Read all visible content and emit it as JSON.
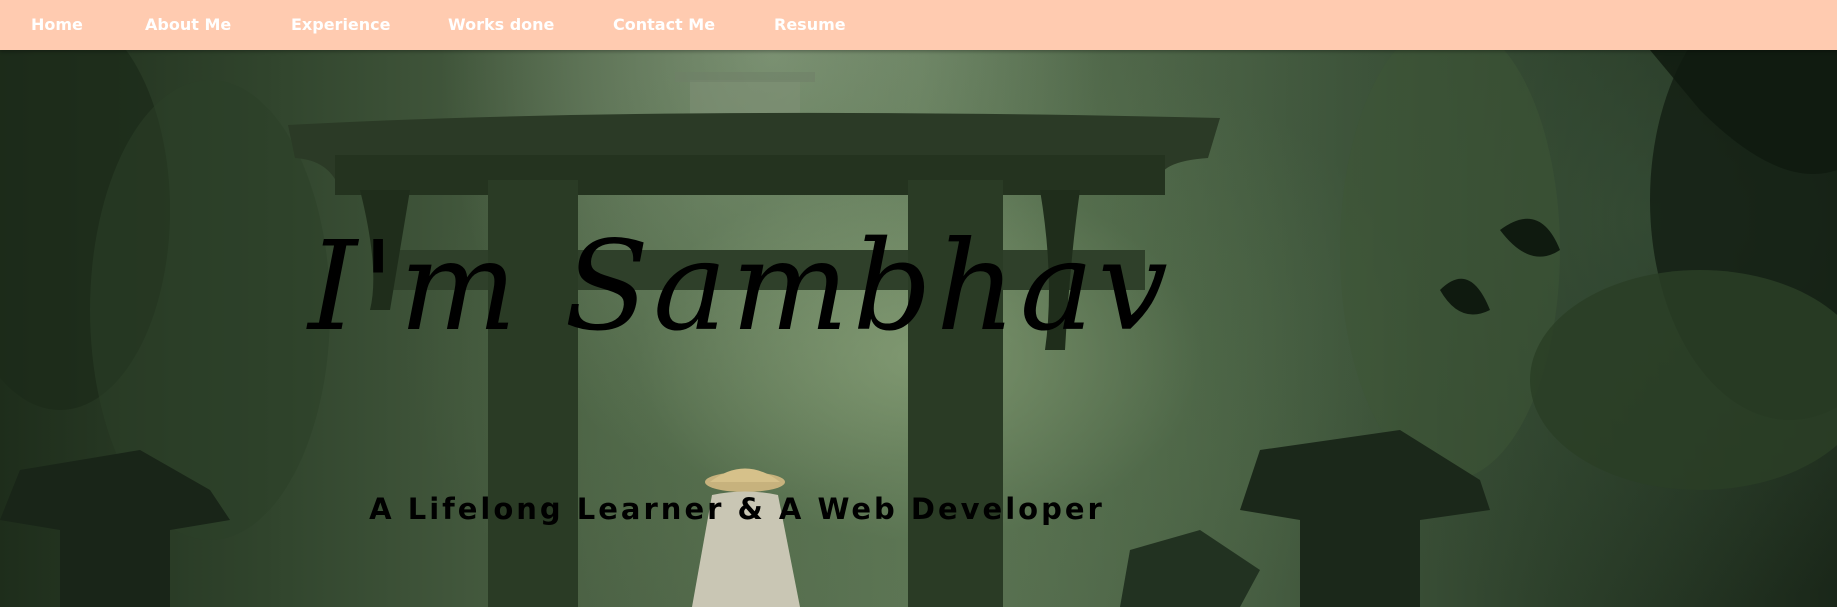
{
  "nav": {
    "items": [
      {
        "label": "Home"
      },
      {
        "label": "About Me"
      },
      {
        "label": "Experience"
      },
      {
        "label": "Works done"
      },
      {
        "label": "Contact Me"
      },
      {
        "label": "Resume"
      }
    ]
  },
  "hero": {
    "title": "I'm Sambhav",
    "subtitle": "A Lifelong Learner & A Web Developer",
    "background": "forest torii gate with monk in straw hat"
  },
  "colors": {
    "navbar": "#ffcbb0",
    "nav_text": "#ffffff",
    "hero_text": "#000000"
  }
}
